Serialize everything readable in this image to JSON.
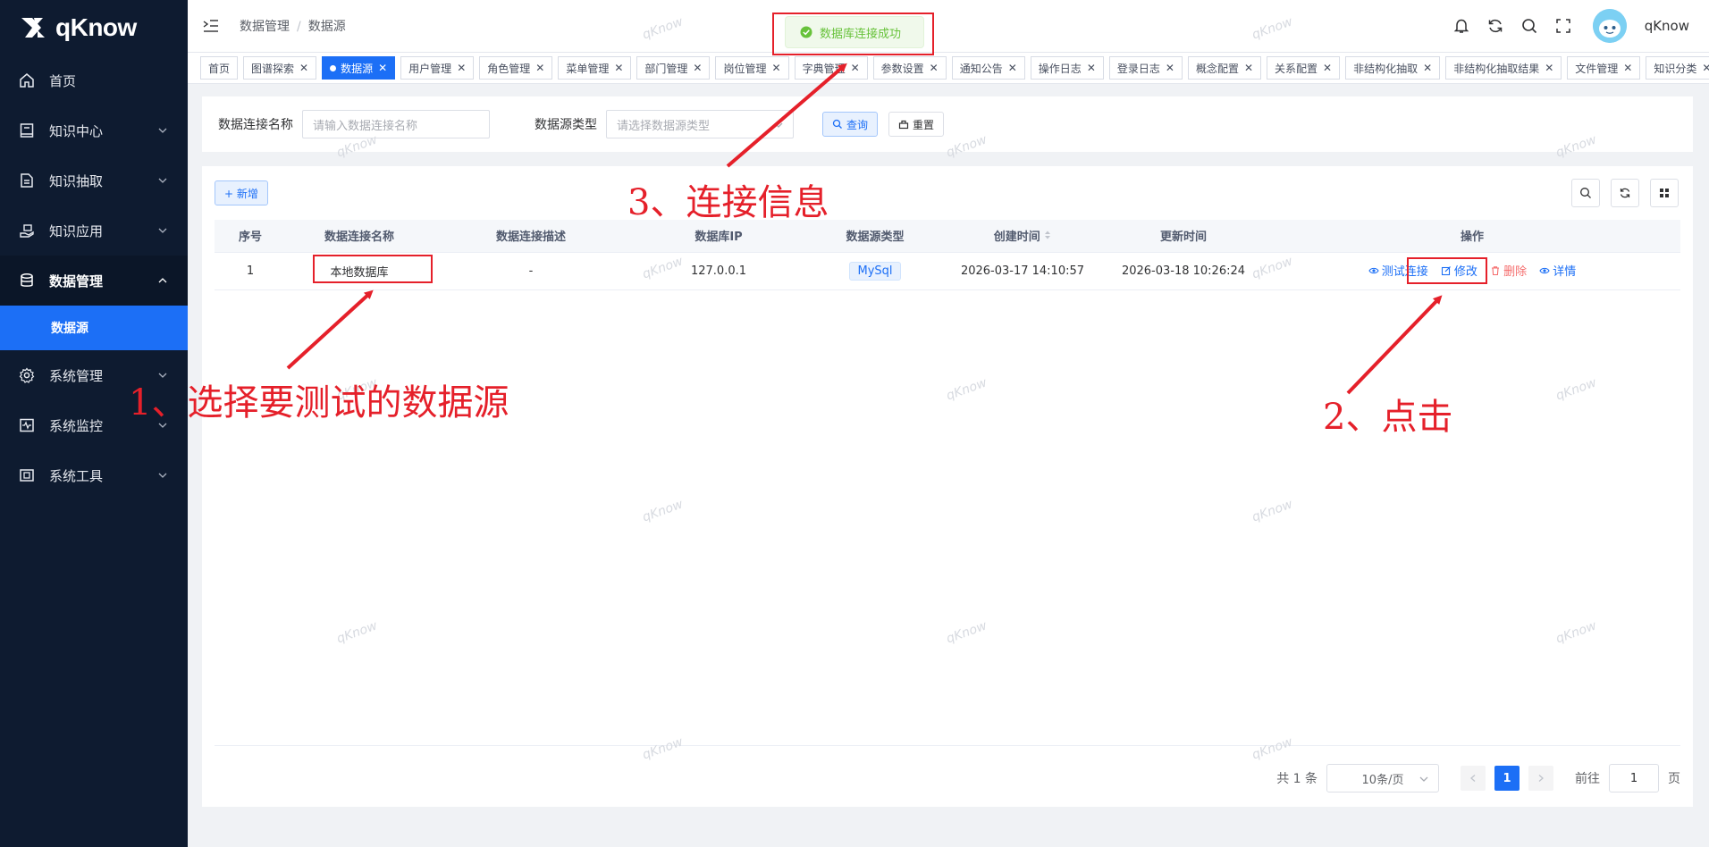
{
  "app": {
    "logo": "qKnow"
  },
  "sidebar": {
    "items": [
      {
        "label": "首页",
        "icon": "home-icon",
        "expandable": false
      },
      {
        "label": "知识中心",
        "icon": "book-icon",
        "expandable": true
      },
      {
        "label": "知识抽取",
        "icon": "document-icon",
        "expandable": true
      },
      {
        "label": "知识应用",
        "icon": "hand-icon",
        "expandable": true
      },
      {
        "label": "数据管理",
        "icon": "database-icon",
        "expandable": true,
        "open": true
      },
      {
        "label": "系统管理",
        "icon": "gear-icon",
        "expandable": true
      },
      {
        "label": "系统监控",
        "icon": "monitor-icon",
        "expandable": true
      },
      {
        "label": "系统工具",
        "icon": "toolbox-icon",
        "expandable": true
      }
    ],
    "subitem": "数据源"
  },
  "header": {
    "breadcrumb": [
      "数据管理",
      "数据源"
    ],
    "username": "qKnow"
  },
  "tags": [
    {
      "label": "首页",
      "closable": false,
      "active": false
    },
    {
      "label": "图谱探索",
      "closable": true,
      "active": false
    },
    {
      "label": "数据源",
      "closable": true,
      "active": true
    },
    {
      "label": "用户管理",
      "closable": true,
      "active": false
    },
    {
      "label": "角色管理",
      "closable": true,
      "active": false
    },
    {
      "label": "菜单管理",
      "closable": true,
      "active": false
    },
    {
      "label": "部门管理",
      "closable": true,
      "active": false
    },
    {
      "label": "岗位管理",
      "closable": true,
      "active": false
    },
    {
      "label": "字典管理",
      "closable": true,
      "active": false
    },
    {
      "label": "参数设置",
      "closable": true,
      "active": false
    },
    {
      "label": "通知公告",
      "closable": true,
      "active": false
    },
    {
      "label": "操作日志",
      "closable": true,
      "active": false
    },
    {
      "label": "登录日志",
      "closable": true,
      "active": false
    },
    {
      "label": "概念配置",
      "closable": true,
      "active": false
    },
    {
      "label": "关系配置",
      "closable": true,
      "active": false
    },
    {
      "label": "非结构化抽取",
      "closable": true,
      "active": false
    },
    {
      "label": "非结构化抽取结果",
      "closable": true,
      "active": false
    },
    {
      "label": "文件管理",
      "closable": true,
      "active": false
    },
    {
      "label": "知识分类",
      "closable": true,
      "active": false
    }
  ],
  "search": {
    "name_label": "数据连接名称",
    "name_placeholder": "请输入数据连接名称",
    "type_label": "数据源类型",
    "type_placeholder": "请选择数据源类型",
    "query_button": "查询",
    "reset_button": "重置"
  },
  "toolbar": {
    "add_button": "+ 新增"
  },
  "table": {
    "columns": [
      "序号",
      "数据连接名称",
      "数据连接描述",
      "数据库IP",
      "数据源类型",
      "创建时间",
      "更新时间",
      "操作"
    ],
    "rows": [
      {
        "index": "1",
        "name": "本地数据库",
        "desc": "-",
        "ip": "127.0.0.1",
        "type": "MySql",
        "created": "2026-03-17 14:10:57",
        "updated": "2026-03-18 10:26:24"
      }
    ],
    "actions": {
      "test": "测试连接",
      "edit": "修改",
      "delete": "删除",
      "detail": "详情"
    }
  },
  "pagination": {
    "total": "共 1 条",
    "page_size": "10条/页",
    "current": "1",
    "goto_label": "前往",
    "goto_value": "1",
    "page_suffix": "页"
  },
  "toast": {
    "message": "数据库连接成功"
  },
  "annotations": {
    "step1": "1、选择要测试的数据源",
    "step2": "2、点击",
    "step3": "3、连接信息"
  },
  "watermark": "qKnow",
  "colors": {
    "primary": "#1c6ff6",
    "sidebar": "#0e1b30",
    "annotation": "#e5202a",
    "success": "#67c23a"
  }
}
